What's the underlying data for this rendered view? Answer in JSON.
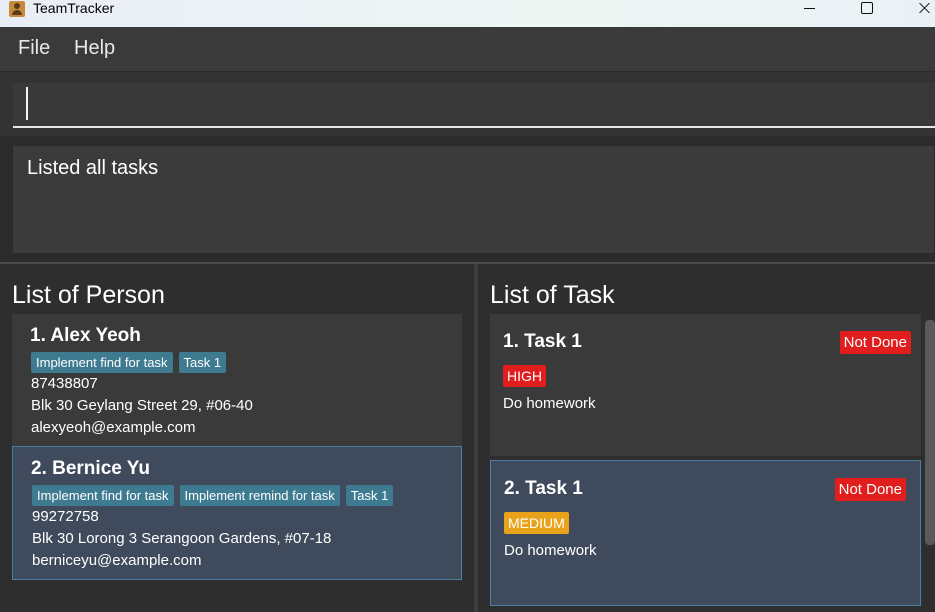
{
  "window": {
    "title": "TeamTracker"
  },
  "menu": {
    "file": "File",
    "help": "Help"
  },
  "command": {
    "value": ""
  },
  "result": {
    "text": "Listed all tasks"
  },
  "persons": {
    "title": "List of Person",
    "items": [
      {
        "name": "1.  Alex Yeoh",
        "tags": [
          "Implement find for task",
          "Task 1"
        ],
        "phone": "87438807",
        "address": "Blk 30 Geylang Street 29, #06-40",
        "email": "alexyeoh@example.com"
      },
      {
        "name": "2.  Bernice Yu",
        "tags": [
          "Implement find for task",
          "Implement remind for task",
          "Task 1"
        ],
        "phone": "99272758",
        "address": "Blk 30 Lorong 3 Serangoon Gardens, #07-18",
        "email": "berniceyu@example.com"
      }
    ]
  },
  "tasks": {
    "title": "List of Task",
    "items": [
      {
        "name": "1. Task 1",
        "status": "Not Done",
        "priority": "HIGH",
        "description": "Do homework"
      },
      {
        "name": "2. Task 1",
        "status": "Not Done",
        "priority": "MEDIUM",
        "description": "Do homework"
      }
    ]
  },
  "colors": {
    "tag": "#3e7b91",
    "status_not_done": "#e11d1d",
    "priority_high": "#e11d1d",
    "priority_medium": "#e9a31a",
    "selected_card": "#3f4a5c"
  }
}
